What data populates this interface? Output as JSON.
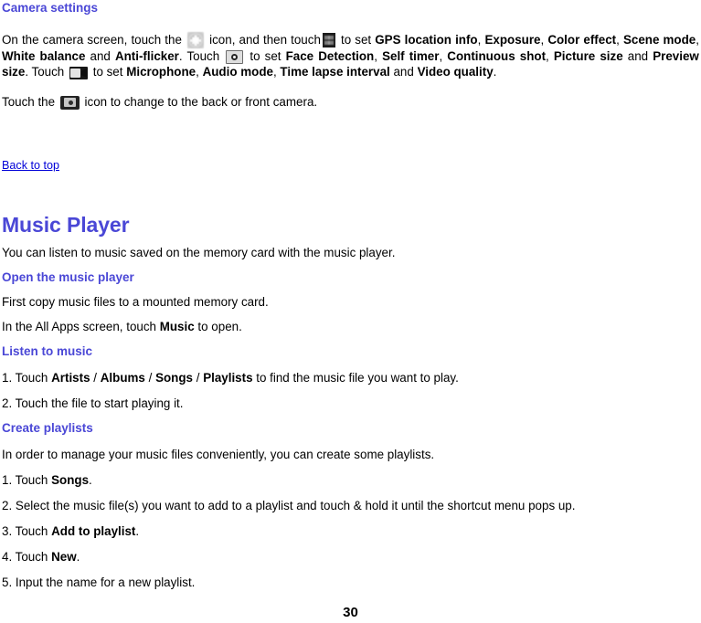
{
  "document": {
    "page_number": "30",
    "accent_heading_color": "#4a47d6",
    "link_color": "#0000d8",
    "body_color": "#000000"
  },
  "camera_section": {
    "heading": "Camera settings",
    "paragraph": {
      "seg1": "On the camera screen, touch the",
      "icon1": "gear-settings-icon",
      "seg2": "icon, and then touch",
      "icon2": "camera-settings-grid-icon",
      "seg3": "to set",
      "b1": "GPS location info",
      "sep1": ",",
      "b2": "Exposure",
      "sep2": ",",
      "b3": "Color effect",
      "sep3": ",",
      "b4": "Scene mode",
      "sep4": ",",
      "b5": "White balance",
      "seg4": "and",
      "b6": "Anti-flicker",
      "sep5": ". Touch",
      "icon3": "photo-camera-icon",
      "seg5": "to set",
      "b7": "Face Detection",
      "sep6": ",",
      "b8": "Self timer",
      "sep7": ",",
      "b9": "Continuous shot",
      "sep8": ",",
      "b10": "Picture size",
      "seg6": "and",
      "b11": "Preview size",
      "sep9": ". Touch",
      "icon4": "video-camera-icon",
      "seg7": "to set",
      "b12": "Microphone",
      "sep10": ",",
      "b13": "Audio mode",
      "sep11": ",",
      "b14": "Time lapse interval",
      "seg8": "and",
      "b15": "Video quality",
      "sep12": "."
    },
    "switch_line": {
      "seg1": "Touch the",
      "icon": "switch-camera-icon",
      "seg2": "icon to change to the back or front camera."
    }
  },
  "back_to_top": {
    "label": "Back to top"
  },
  "music_section": {
    "title": "Music Player",
    "intro": "You can listen to music saved on the memory card with the music player.",
    "open_player": {
      "heading": "Open the music player",
      "line1": "First copy music files to a mounted memory card.",
      "line2_pre": "In the All Apps screen, touch",
      "line2_bold": "Music",
      "line2_post": "to open."
    },
    "listen": {
      "heading": "Listen to music",
      "step1_pre": "1. Touch",
      "step1_b1": "Artists",
      "step1_sep1": "/",
      "step1_b2": "Albums",
      "step1_sep2": "/",
      "step1_b3": "Songs",
      "step1_sep3": "/",
      "step1_b4": "Playlists",
      "step1_post": "to find the music file you want to play.",
      "step2": "2. Touch the file to start playing it."
    },
    "create_playlists": {
      "heading": "Create playlists",
      "intro": "In order to manage your music files conveniently, you can create some playlists.",
      "step1_pre": "1. Touch",
      "step1_bold": "Songs",
      "step1_post": ".",
      "step2": "2. Select the music file(s) you want to add to a playlist and touch & hold it until the shortcut menu pops up.",
      "step3_pre": "3. Touch",
      "step3_bold": "Add to playlist",
      "step3_post": ".",
      "step4_pre": "4. Touch",
      "step4_bold": "New",
      "step4_post": ".",
      "step5": "5. Input the name for a new playlist."
    }
  }
}
